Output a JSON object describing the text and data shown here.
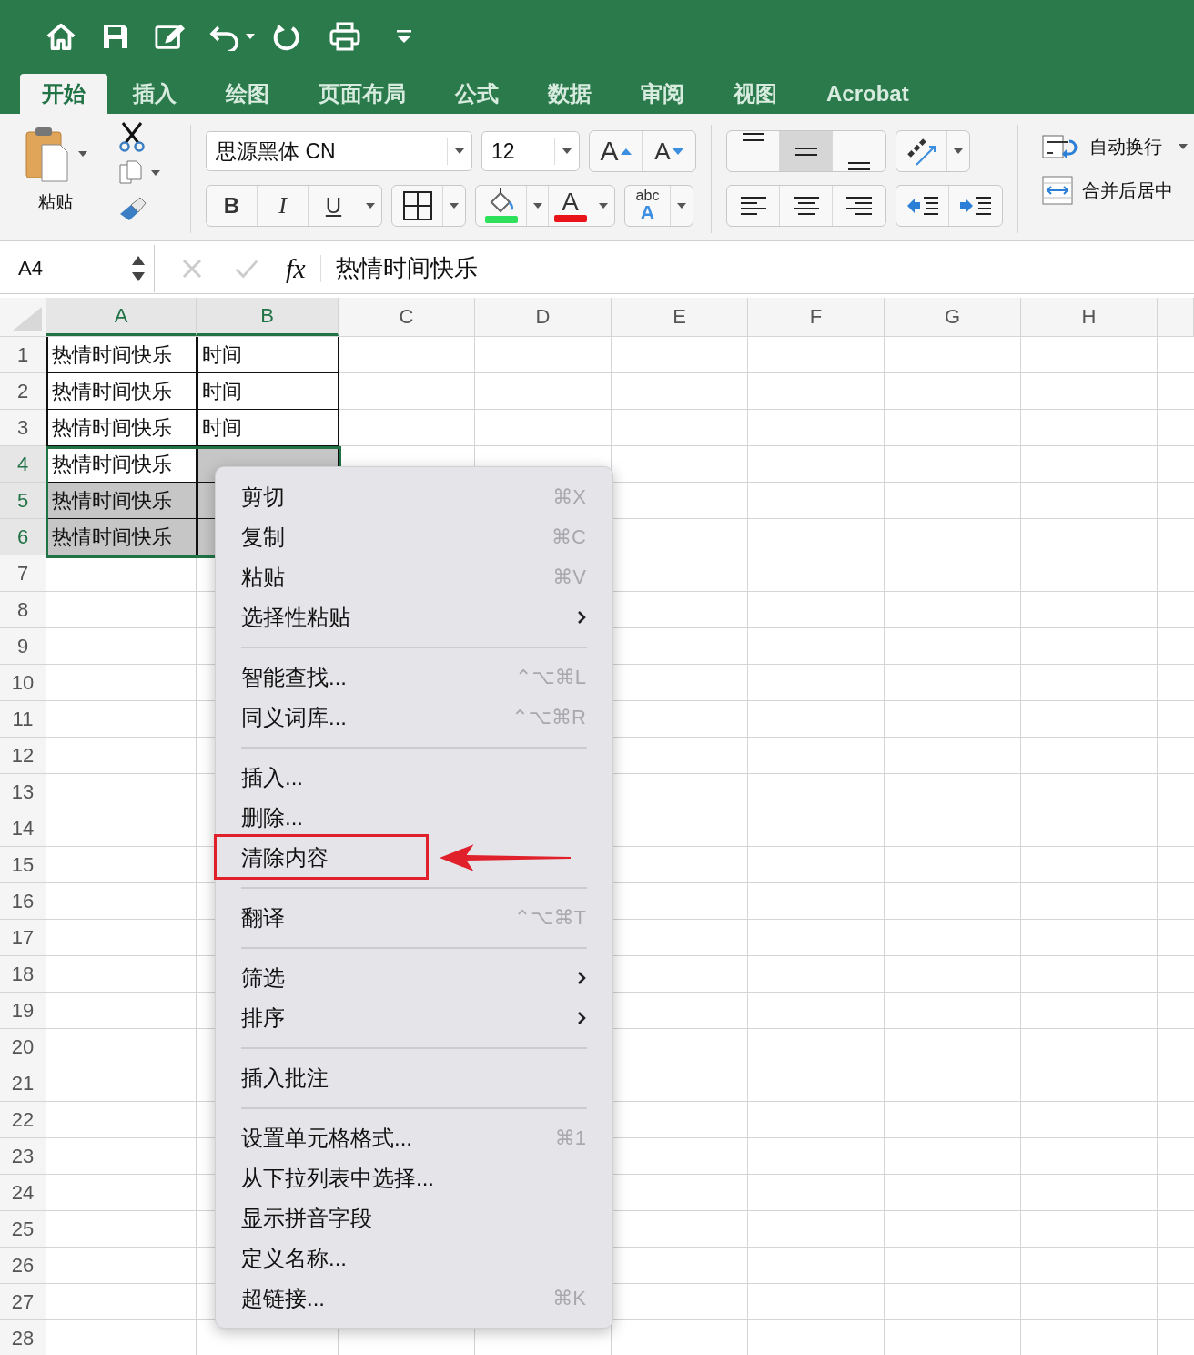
{
  "tabs": [
    {
      "label": "开始",
      "selected": true
    },
    {
      "label": "插入",
      "selected": false
    },
    {
      "label": "绘图",
      "selected": false
    },
    {
      "label": "页面布局",
      "selected": false
    },
    {
      "label": "公式",
      "selected": false
    },
    {
      "label": "数据",
      "selected": false
    },
    {
      "label": "审阅",
      "selected": false
    },
    {
      "label": "视图",
      "selected": false
    },
    {
      "label": "Acrobat",
      "selected": false
    }
  ],
  "ribbon": {
    "paste_label": "粘贴",
    "font_name": "思源黑体 CN",
    "font_size": "12",
    "grow_font": "A",
    "shrink_font": "A",
    "bold": "B",
    "italic": "I",
    "underline": "U",
    "font_color": "A",
    "phonetic_top": "abc",
    "phonetic_bottom": "A",
    "vertical_align": [
      {
        "selected": false
      },
      {
        "selected": true
      },
      {
        "selected": false
      }
    ],
    "wrap_text": "自动换行",
    "merge_center": "合并后居中"
  },
  "formula_bar": {
    "name_box": "A4",
    "fx": "fx",
    "formula": "热情时间快乐"
  },
  "columns": [
    {
      "label": "A",
      "selected": true
    },
    {
      "label": "B",
      "selected": true
    },
    {
      "label": "C",
      "selected": false
    },
    {
      "label": "D",
      "selected": false
    },
    {
      "label": "E",
      "selected": false
    },
    {
      "label": "F",
      "selected": false
    },
    {
      "label": "G",
      "selected": false
    },
    {
      "label": "H",
      "selected": false
    }
  ],
  "rows": [
    {
      "number": "1",
      "selected": false,
      "cells": [
        {
          "value": "热情时间快乐",
          "selected": false
        },
        {
          "value": "时间",
          "selected": false
        }
      ]
    },
    {
      "number": "2",
      "selected": false,
      "cells": [
        {
          "value": "热情时间快乐",
          "selected": false
        },
        {
          "value": "时间",
          "selected": false
        }
      ]
    },
    {
      "number": "3",
      "selected": false,
      "cells": [
        {
          "value": "热情时间快乐",
          "selected": false
        },
        {
          "value": "时间",
          "selected": false
        }
      ]
    },
    {
      "number": "4",
      "selected": true,
      "cells": [
        {
          "value": "热情时间快乐",
          "selected": false
        },
        {
          "selected": true
        }
      ]
    },
    {
      "number": "5",
      "selected": true,
      "cells": [
        {
          "value": "热情时间快乐",
          "selected": true
        },
        {
          "selected": true
        }
      ]
    },
    {
      "number": "6",
      "selected": true,
      "cells": [
        {
          "value": "热情时间快乐",
          "selected": true
        },
        {
          "selected": true
        }
      ]
    },
    {
      "number": "7",
      "selected": false
    },
    {
      "number": "8",
      "selected": false
    },
    {
      "number": "9",
      "selected": false
    },
    {
      "number": "10",
      "selected": false
    },
    {
      "number": "11",
      "selected": false
    },
    {
      "number": "12",
      "selected": false
    },
    {
      "number": "13",
      "selected": false
    },
    {
      "number": "14",
      "selected": false
    },
    {
      "number": "15",
      "selected": false
    },
    {
      "number": "16",
      "selected": false
    },
    {
      "number": "17",
      "selected": false
    },
    {
      "number": "18",
      "selected": false
    },
    {
      "number": "19",
      "selected": false
    },
    {
      "number": "20",
      "selected": false
    },
    {
      "number": "21",
      "selected": false
    },
    {
      "number": "22",
      "selected": false
    },
    {
      "number": "23",
      "selected": false
    },
    {
      "number": "24",
      "selected": false
    },
    {
      "number": "25",
      "selected": false
    },
    {
      "number": "26",
      "selected": false
    },
    {
      "number": "27",
      "selected": false
    },
    {
      "number": "28",
      "selected": false
    }
  ],
  "context_menu": [
    {
      "kind": "item",
      "label": "剪切",
      "shortcut": "⌘X",
      "submenu": false,
      "annotated": false
    },
    {
      "kind": "item",
      "label": "复制",
      "shortcut": "⌘C",
      "submenu": false,
      "annotated": false
    },
    {
      "kind": "item",
      "label": "粘贴",
      "shortcut": "⌘V",
      "submenu": false,
      "annotated": false
    },
    {
      "kind": "item",
      "label": "选择性粘贴",
      "submenu": true,
      "annotated": false
    },
    {
      "kind": "separator"
    },
    {
      "kind": "item",
      "label": "智能查找...",
      "shortcut": "⌃⌥⌘L",
      "submenu": false,
      "annotated": false
    },
    {
      "kind": "item",
      "label": "同义词库...",
      "shortcut": "⌃⌥⌘R",
      "submenu": false,
      "annotated": false
    },
    {
      "kind": "separator"
    },
    {
      "kind": "item",
      "label": "插入...",
      "submenu": false,
      "annotated": false
    },
    {
      "kind": "item",
      "label": "删除...",
      "submenu": false,
      "annotated": false
    },
    {
      "kind": "item",
      "label": "清除内容",
      "submenu": false,
      "annotated": true
    },
    {
      "kind": "separator"
    },
    {
      "kind": "item",
      "label": "翻译",
      "shortcut": "⌃⌥⌘T",
      "submenu": false,
      "annotated": false
    },
    {
      "kind": "separator"
    },
    {
      "kind": "item",
      "label": "筛选",
      "submenu": true,
      "annotated": false
    },
    {
      "kind": "item",
      "label": "排序",
      "submenu": true,
      "annotated": false
    },
    {
      "kind": "separator"
    },
    {
      "kind": "item",
      "label": "插入批注",
      "submenu": false,
      "annotated": false
    },
    {
      "kind": "separator"
    },
    {
      "kind": "item",
      "label": "设置单元格格式...",
      "shortcut": "⌘1",
      "submenu": false,
      "annotated": false
    },
    {
      "kind": "item",
      "label": "从下拉列表中选择...",
      "submenu": false,
      "annotated": false
    },
    {
      "kind": "item",
      "label": "显示拼音字段",
      "submenu": false,
      "annotated": false
    },
    {
      "kind": "item",
      "label": "定义名称...",
      "submenu": false,
      "annotated": false
    },
    {
      "kind": "item",
      "label": "超链接...",
      "shortcut": "⌘K",
      "submenu": false,
      "annotated": false
    }
  ]
}
